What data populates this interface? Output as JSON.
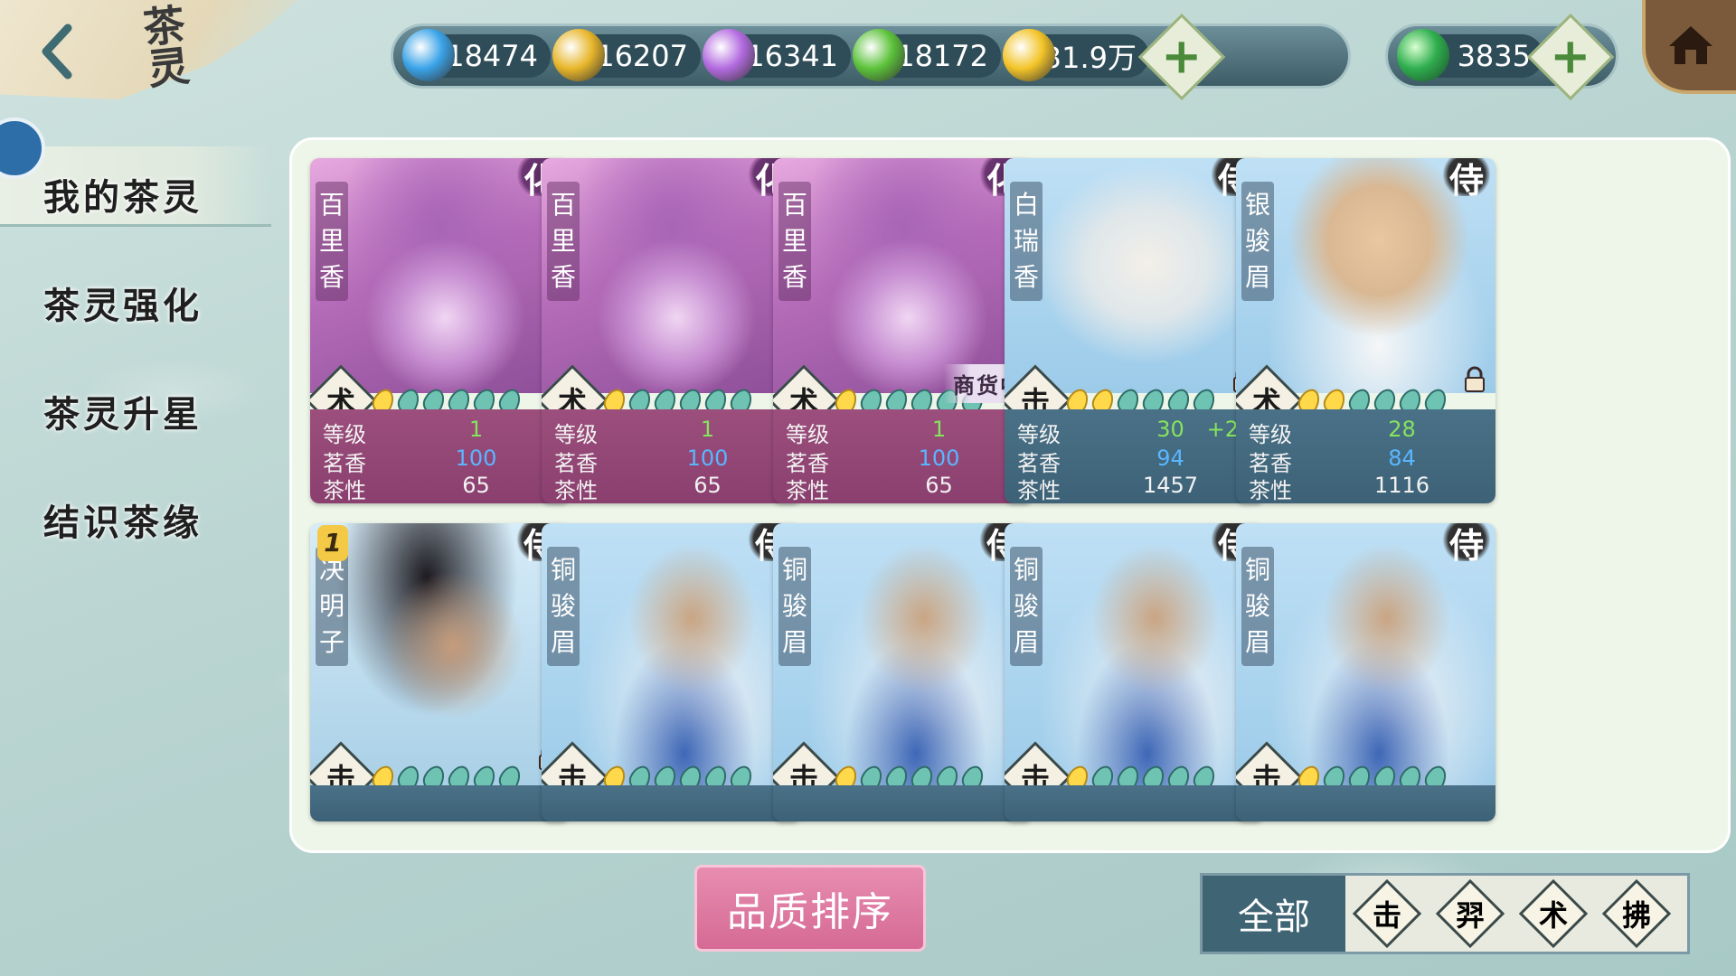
{
  "header": {
    "title": "茶灵",
    "currencies": [
      {
        "name": "blue-crystal-currency",
        "value": "18474",
        "color": "#3aa3e8"
      },
      {
        "name": "gold-crystal-currency",
        "value": "16207",
        "color": "#e8b62a"
      },
      {
        "name": "purple-crystal-currency",
        "value": "16341",
        "color": "#b36be0"
      },
      {
        "name": "green-crystal-currency",
        "value": "18172",
        "color": "#5cc23a"
      },
      {
        "name": "coin-currency",
        "value": "31.9万",
        "color": "#f3c428"
      }
    ],
    "gem": {
      "value": "3835",
      "color": "#2fae4e"
    },
    "plus_label": "+"
  },
  "sidebar": {
    "items": [
      {
        "label": "我的茶灵",
        "active": true
      },
      {
        "label": "茶灵强化",
        "active": false
      },
      {
        "label": "茶灵升星",
        "active": false
      },
      {
        "label": "结识茶缘",
        "active": false
      }
    ]
  },
  "stat_labels": {
    "level": "等级",
    "aroma": "茗香",
    "nature": "茶性"
  },
  "cards_row1": [
    {
      "name": "百里香",
      "class": "化",
      "type": "术",
      "theme": "purple",
      "gold_leaves": 1,
      "level": "1",
      "level_bonus": "",
      "aroma": "100",
      "nature": "65",
      "tag": "",
      "locked": false
    },
    {
      "name": "百里香",
      "class": "化",
      "type": "术",
      "theme": "purple",
      "gold_leaves": 1,
      "level": "1",
      "level_bonus": "",
      "aroma": "100",
      "nature": "65",
      "tag": "",
      "locked": false
    },
    {
      "name": "百里香",
      "class": "化",
      "type": "术",
      "theme": "purple",
      "gold_leaves": 1,
      "level": "1",
      "level_bonus": "",
      "aroma": "100",
      "nature": "65",
      "tag": "商货中",
      "locked": false
    },
    {
      "name": "白瑞香",
      "class": "侍",
      "type": "击",
      "theme": "blue",
      "gold_leaves": 2,
      "level": "30",
      "level_bonus": "+2",
      "aroma": "94",
      "nature": "1457",
      "tag": "",
      "locked": true
    },
    {
      "name": "银骏眉",
      "class": "侍",
      "type": "术",
      "theme": "blue",
      "gold_leaves": 2,
      "level": "28",
      "level_bonus": "",
      "aroma": "84",
      "nature": "1116",
      "tag": "",
      "locked": true
    }
  ],
  "cards_row2": [
    {
      "name": "决明子",
      "class": "侍",
      "type": "击",
      "star": "1",
      "gold_leaves": 1,
      "locked": true
    },
    {
      "name": "铜骏眉",
      "class": "侍",
      "type": "击",
      "star": "",
      "gold_leaves": 1,
      "locked": false
    },
    {
      "name": "铜骏眉",
      "class": "侍",
      "type": "击",
      "star": "",
      "gold_leaves": 1,
      "locked": false
    },
    {
      "name": "铜骏眉",
      "class": "侍",
      "type": "击",
      "star": "",
      "gold_leaves": 1,
      "locked": false
    },
    {
      "name": "铜骏眉",
      "class": "侍",
      "type": "击",
      "star": "",
      "gold_leaves": 1,
      "locked": false
    }
  ],
  "controls": {
    "sort_label": "品质排序",
    "filter_all": "全部",
    "filters": [
      "击",
      "羿",
      "术",
      "拂"
    ]
  }
}
